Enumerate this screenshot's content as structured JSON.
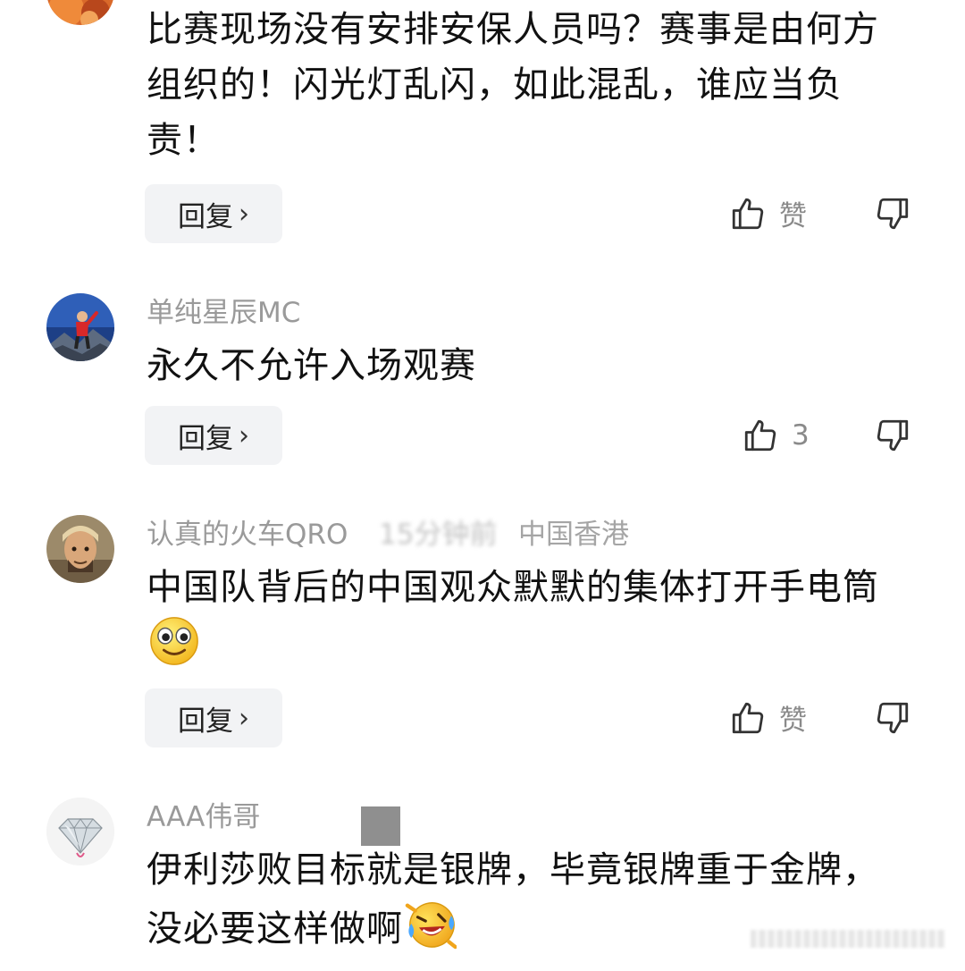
{
  "comments": [
    {
      "text": "比赛现场没有安排安保人员吗？赛事是由何方组织的！闪光灯乱闪，如此混乱，谁应当负责！",
      "reply_label": "回复",
      "like_label": "赞"
    },
    {
      "username": "单纯星辰MC",
      "text": "永久不允许入场观赛",
      "reply_label": "回复",
      "like_label": "3"
    },
    {
      "username": "认真的火车QRO",
      "time": "15分钟前",
      "location": "中国香港",
      "text": "中国队背后的中国观众默默的集体打开手电筒",
      "reply_label": "回复",
      "like_label": "赞"
    },
    {
      "username": "AAA伟哥",
      "text": "伊利莎败目标就是银牌，毕竟银牌重于金牌，没必要这样做啊"
    }
  ],
  "icons": {
    "thumb_up": "thumbs-up-icon",
    "thumb_down": "thumbs-down-icon",
    "chevron": "chevron-right-icon",
    "emoji_smile": "smiling-face-emoji",
    "emoji_laugh": "laughing-crying-emoji"
  },
  "colors": {
    "text": "#111111",
    "username": "#9a9a9a",
    "reply_bg": "#f2f3f5",
    "icon": "#333333"
  }
}
